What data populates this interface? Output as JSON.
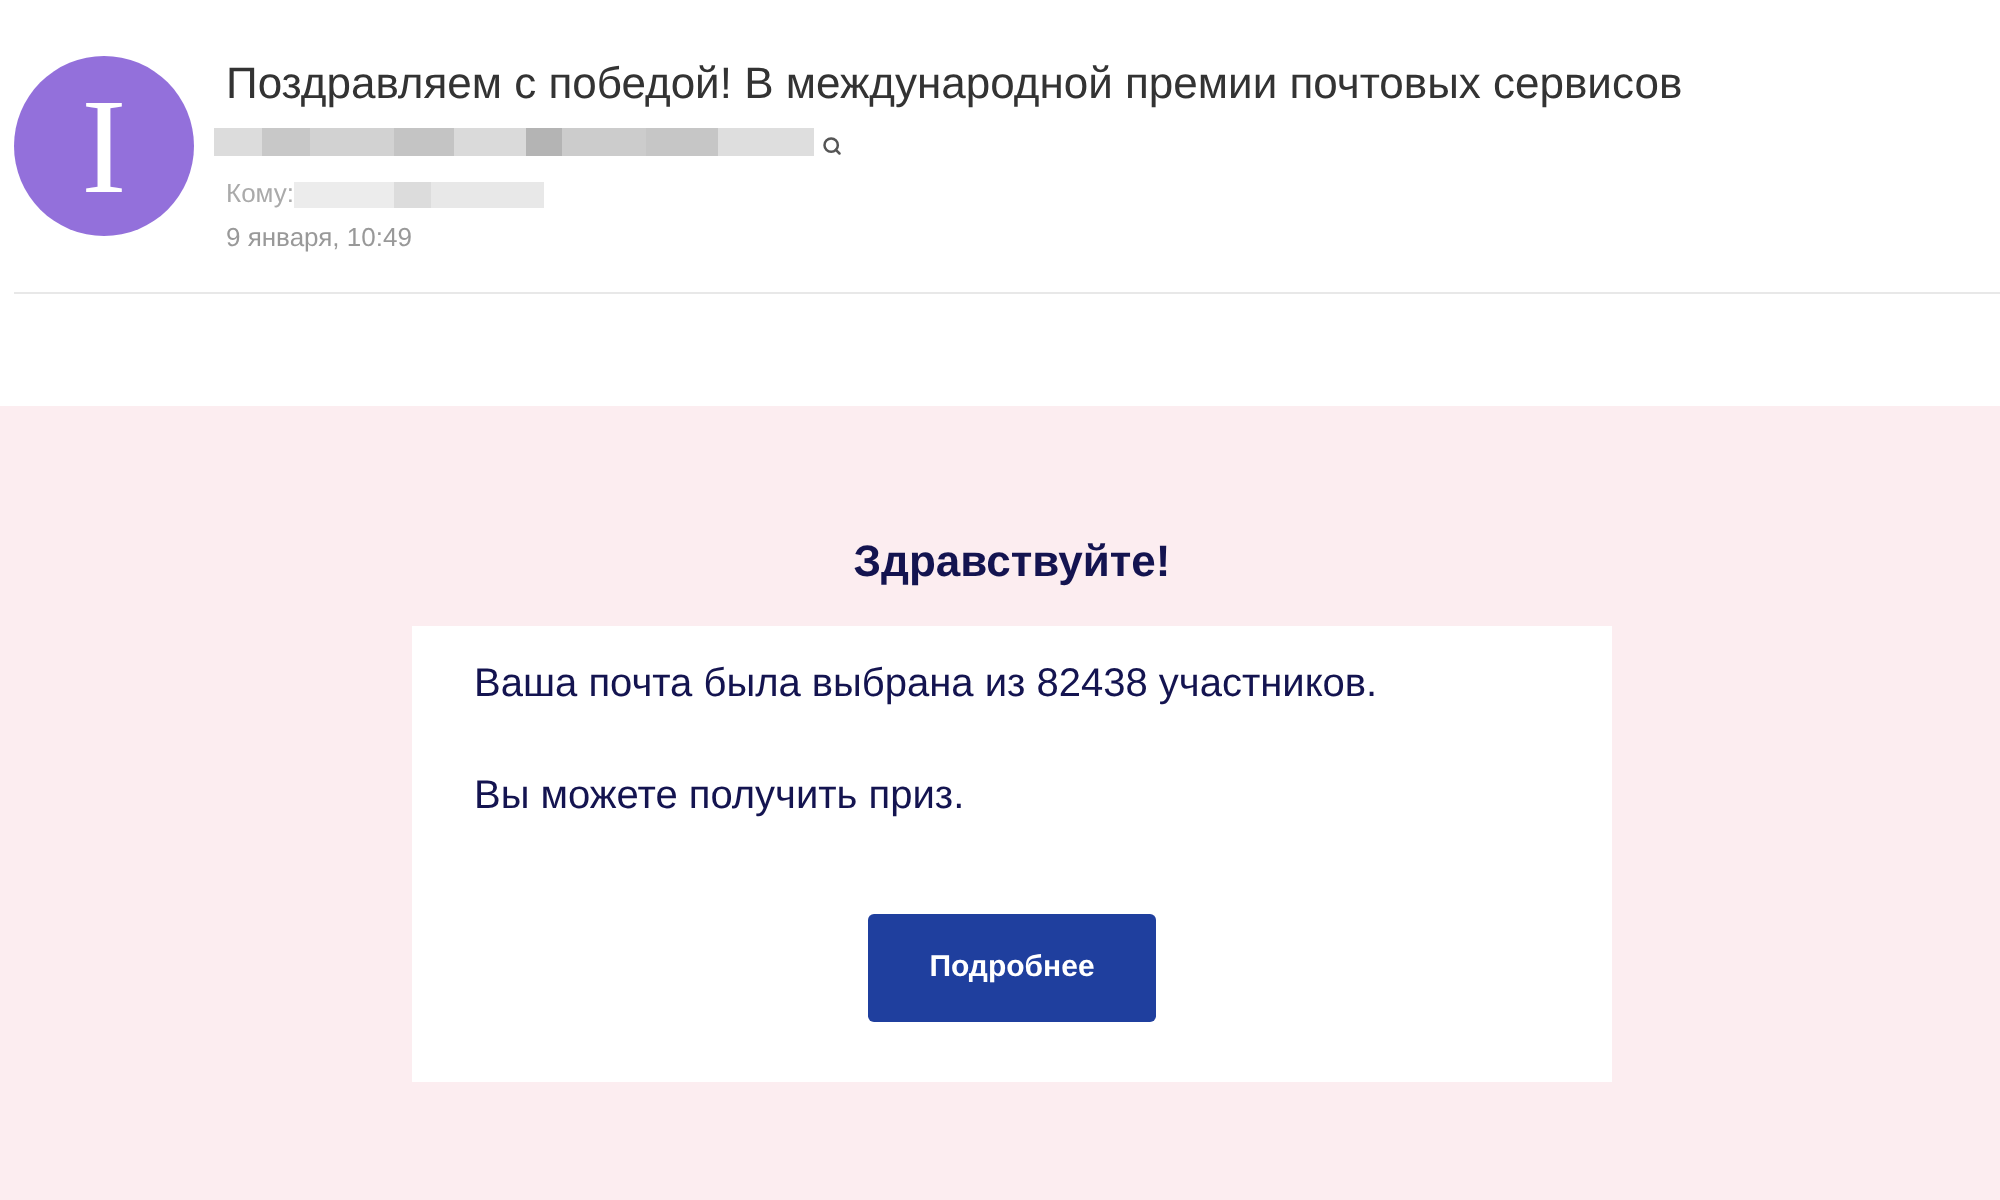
{
  "message": {
    "avatar_letter": "I",
    "subject": "Поздравляем с победой! В международной премии почтовых сервисов",
    "to_label": "Кому:",
    "date": "9 января, 10:49"
  },
  "body": {
    "greeting": "Здравствуйте!",
    "paragraphs": [
      "Ваша почта была выбрана из 82438 участников.",
      "Вы можете получить приз."
    ],
    "button": "Подробнее"
  }
}
